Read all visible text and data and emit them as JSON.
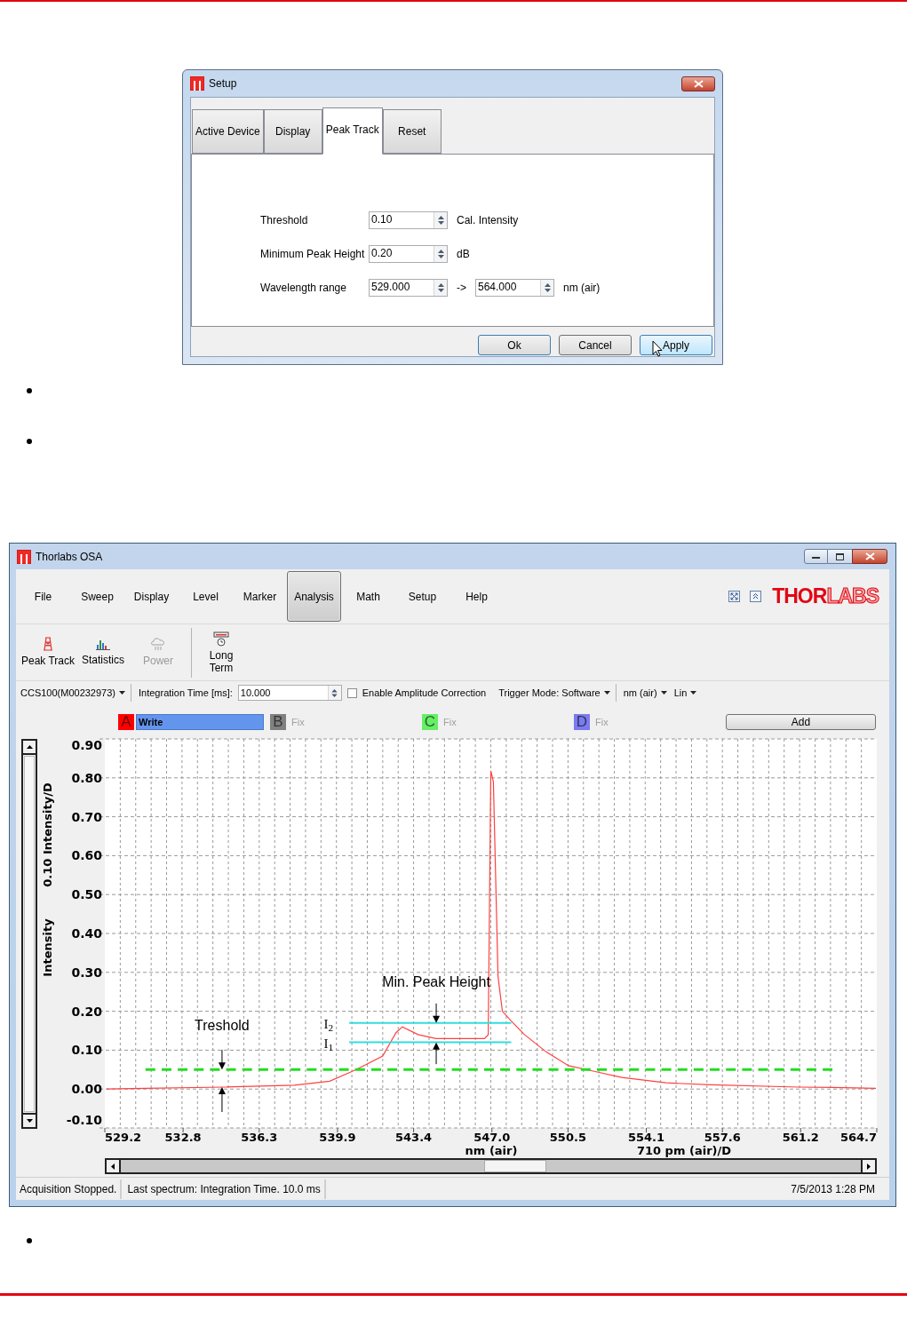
{
  "setup_dialog": {
    "title": "Setup",
    "tabs": [
      {
        "label": "Active Device",
        "selected": false
      },
      {
        "label": "Display",
        "selected": false
      },
      {
        "label": "Peak Track",
        "selected": true
      },
      {
        "label": "Reset",
        "selected": false
      }
    ],
    "fields": [
      {
        "label": "Threshold",
        "values": [
          "0.10"
        ],
        "unit": "Cal. Intensity"
      },
      {
        "label": "Minimum Peak Height",
        "values": [
          "0.20"
        ],
        "unit": "dB"
      },
      {
        "label": "Wavelength range",
        "values": [
          "529.000",
          "564.000"
        ],
        "separator": "->",
        "unit": "nm (air)"
      }
    ],
    "buttons": [
      {
        "label": "Ok",
        "kind": "default"
      },
      {
        "label": "Cancel",
        "kind": "normal"
      },
      {
        "label": "Apply",
        "kind": "hover"
      }
    ]
  },
  "osa_window": {
    "title": "Thorlabs OSA",
    "menu_tabs": [
      {
        "label": "File",
        "selected": false
      },
      {
        "label": "Sweep",
        "selected": false
      },
      {
        "label": "Display",
        "selected": false
      },
      {
        "label": "Level",
        "selected": false
      },
      {
        "label": "Marker",
        "selected": false
      },
      {
        "label": "Analysis",
        "selected": true
      },
      {
        "label": "Math",
        "selected": false
      },
      {
        "label": "Setup",
        "selected": false
      },
      {
        "label": "Help",
        "selected": false
      }
    ],
    "logo": [
      "THOR",
      "LABS"
    ],
    "toolbar_groups": [
      [
        {
          "label": "Peak Track",
          "kind": "peak",
          "disabled": false
        },
        {
          "label": "Statistics",
          "kind": "stats",
          "disabled": false
        },
        {
          "label": "Power",
          "kind": "power",
          "disabled": true
        }
      ],
      [
        {
          "label": "Long Term",
          "kind": "longterm",
          "disabled": false
        }
      ]
    ],
    "device": "CCS100(M00232973)",
    "integration_time": {
      "label": "Integration Time [ms]:",
      "value": "10.000"
    },
    "amplitude_correction": {
      "label": "Enable Amplitude Correction",
      "checked": false
    },
    "trigger_mode": "Trigger Mode: Software",
    "unit": "nm (air)",
    "scale": "Lin",
    "traces": [
      {
        "letter": "A",
        "color": "#ff0000",
        "mode": "Write",
        "selected": true
      },
      {
        "letter": "B",
        "color": "#808080",
        "mode": "Fix",
        "selected": false
      },
      {
        "letter": "C",
        "color": "#66ee66",
        "mode": "Fix",
        "selected": false
      },
      {
        "letter": "D",
        "color": "#7b7bf0",
        "mode": "Fix",
        "selected": false
      }
    ],
    "add_button": "Add",
    "chart": {
      "y_scale_label": "0.10 Intensity/D",
      "x_scale_label": "710 pm (air)/D",
      "chart_data": {
        "type": "line",
        "xlabel": "nm (air)",
        "ylabel": "Intensity",
        "xlim": [
          529.2,
          564.7
        ],
        "ylim": [
          -0.1,
          0.9
        ],
        "grid": true,
        "x": [
          529.28,
          531.07,
          534.66,
          537.91,
          539.54,
          540.44,
          540.76,
          541.98,
          542.59,
          542.88,
          543.61,
          544.43,
          545.65,
          546.66,
          546.83,
          546.95,
          547.07,
          547.28,
          547.48,
          547.89,
          548.5,
          549.51,
          550.53,
          551.75,
          552.97,
          555.01,
          557.05,
          561.12,
          562.66,
          564.66
        ],
        "series": [
          {
            "color": "#ff4040",
            "values": [
              0.0,
              0.002,
              0.005,
              0.01,
              0.02,
              0.042,
              0.05,
              0.085,
              0.145,
              0.16,
              0.14,
              0.13,
              0.13,
              0.13,
              0.14,
              0.818,
              0.79,
              0.29,
              0.2,
              0.175,
              0.14,
              0.095,
              0.06,
              0.045,
              0.03,
              0.016,
              0.011,
              0.005,
              0.004,
              0.002
            ]
          },
          {
            "color": "#22dd22",
            "line_style": "dashed",
            "values": [
              null,
              0.05,
              null,
              null,
              null,
              null,
              null,
              null,
              null,
              null,
              null,
              null,
              null,
              null,
              null,
              null,
              null,
              null,
              null,
              null,
              null,
              null,
              null,
              null,
              null,
              null,
              null,
              null,
              0.05,
              null
            ]
          },
          {
            "color": "#33dddd",
            "values": [
              null,
              null,
              null,
              null,
              null,
              0.17,
              null,
              null,
              null,
              null,
              null,
              null,
              null,
              null,
              null,
              null,
              null,
              null,
              null,
              0.17,
              null,
              null,
              null,
              null,
              null,
              null,
              null,
              null,
              null,
              null
            ]
          },
          {
            "color": "#33dddd",
            "values": [
              null,
              null,
              null,
              null,
              null,
              0.12,
              null,
              null,
              null,
              null,
              null,
              null,
              null,
              null,
              null,
              null,
              null,
              null,
              null,
              0.12,
              null,
              null,
              null,
              null,
              null,
              null,
              null,
              null,
              null,
              null
            ]
          }
        ],
        "xticks": [
          {
            "value": 529.2,
            "label": "529.2"
          },
          {
            "value": 532.8,
            "label": "532.8"
          },
          {
            "value": 536.3,
            "label": "536.3"
          },
          {
            "value": 539.9,
            "label": "539.9"
          },
          {
            "value": 543.4,
            "label": "543.4"
          },
          {
            "value": 547.0,
            "label": "547.0"
          },
          {
            "value": 550.5,
            "label": "550.5"
          },
          {
            "value": 554.1,
            "label": "554.1"
          },
          {
            "value": 557.6,
            "label": "557.6"
          },
          {
            "value": 561.2,
            "label": "561.2"
          },
          {
            "value": 564.7,
            "label": "564.7"
          }
        ],
        "yticks": [
          {
            "value": -0.1,
            "label": "-0.10"
          },
          {
            "value": 0.0,
            "label": "0.00"
          },
          {
            "value": 0.1,
            "label": "0.10"
          },
          {
            "value": 0.2,
            "label": "0.20"
          },
          {
            "value": 0.3,
            "label": "0.30"
          },
          {
            "value": 0.4,
            "label": "0.40"
          },
          {
            "value": 0.5,
            "label": "0.50"
          },
          {
            "value": 0.6,
            "label": "0.60"
          },
          {
            "value": 0.7,
            "label": "0.70"
          },
          {
            "value": 0.8,
            "label": "0.80"
          },
          {
            "value": 0.9,
            "label": "0.90"
          }
        ],
        "annotations": [
          "Treshold",
          "Min. Peak Height",
          "I$_{2}$",
          "I$_{1}$"
        ]
      }
    },
    "status_bar": [
      "Acquisition Stopped.",
      "Last spectrum: Integration Time. 10.0 ms",
      "7/5/2013 1:28 PM"
    ]
  }
}
